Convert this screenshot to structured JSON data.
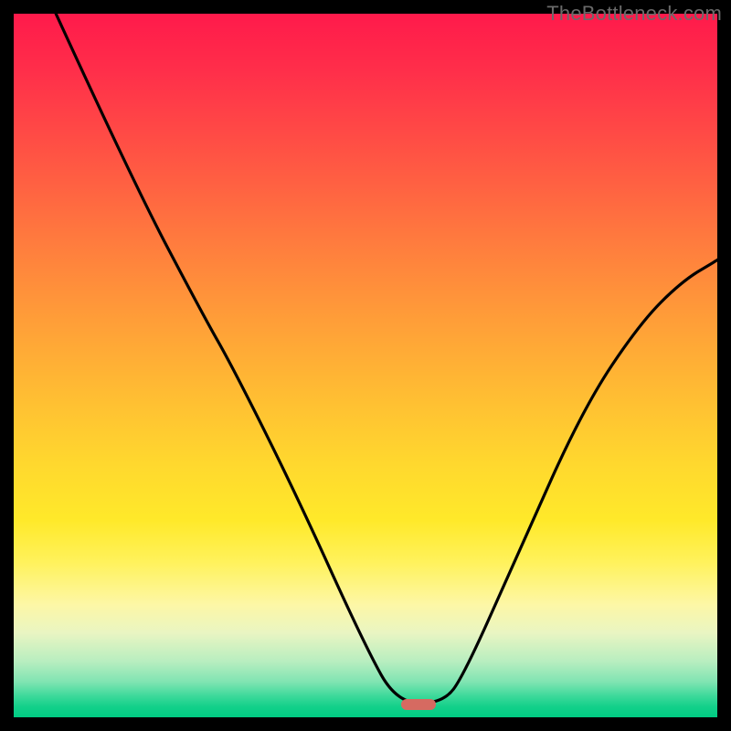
{
  "watermark": "TheBottleneck.com",
  "marker": {
    "x_frac": 0.575,
    "y_frac": 0.982
  },
  "chart_data": {
    "type": "line",
    "title": "",
    "xlabel": "",
    "ylabel": "",
    "xlim": [
      0,
      1
    ],
    "ylim": [
      0,
      1
    ],
    "series": [
      {
        "name": "curve",
        "x": [
          0.06,
          0.17,
          0.27,
          0.31,
          0.4,
          0.5,
          0.545,
          0.61,
          0.64,
          0.72,
          0.81,
          0.89,
          0.95,
          1.0
        ],
        "y": [
          1.0,
          0.76,
          0.57,
          0.5,
          0.32,
          0.1,
          0.02,
          0.02,
          0.06,
          0.24,
          0.44,
          0.56,
          0.62,
          0.65
        ]
      }
    ],
    "annotations": [
      {
        "kind": "pill-marker",
        "x": 0.575,
        "y": 0.018,
        "color": "#d66a61"
      }
    ],
    "background_gradient": {
      "direction": "vertical",
      "stops": [
        {
          "pos": 0.0,
          "color": "#ff1a4b"
        },
        {
          "pos": 0.5,
          "color": "#ffab36"
        },
        {
          "pos": 0.78,
          "color": "#fff25c"
        },
        {
          "pos": 0.92,
          "color": "#b9eec0"
        },
        {
          "pos": 1.0,
          "color": "#00cc83"
        }
      ]
    }
  }
}
